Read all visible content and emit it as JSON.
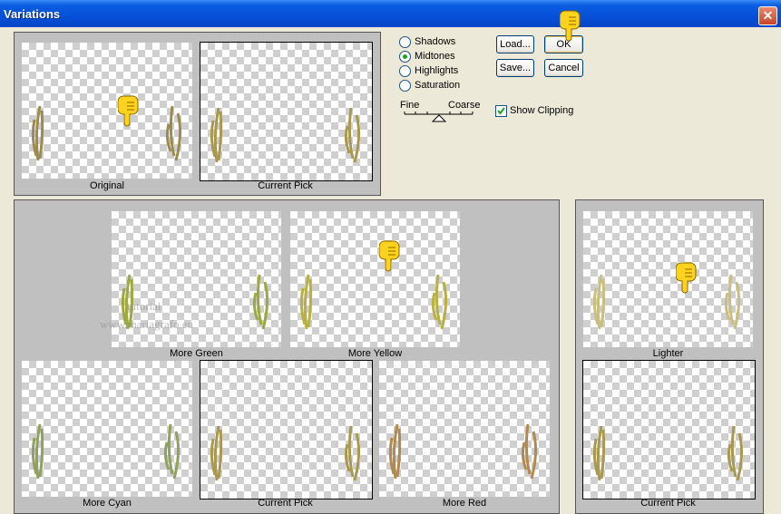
{
  "window": {
    "title": "Variations",
    "close_glyph": "✕"
  },
  "buttons": {
    "load": "Load...",
    "save": "Save...",
    "ok": "OK",
    "cancel": "Cancel"
  },
  "tonal_range": {
    "options": [
      "Shadows",
      "Midtones",
      "Highlights",
      "Saturation"
    ],
    "selected": "Midtones"
  },
  "slider": {
    "min_label": "Fine",
    "max_label": "Coarse"
  },
  "show_clipping": {
    "label": "Show Clipping",
    "checked": true
  },
  "top_thumbnails": {
    "original": "Original",
    "current_pick": "Current Pick"
  },
  "color_grid": {
    "more_green": "More Green",
    "more_yellow": "More Yellow",
    "more_cyan": "More Cyan",
    "current_pick": "Current Pick",
    "more_red": "More Red"
  },
  "lightness": {
    "lighter": "Lighter",
    "current_pick": "Current Pick"
  },
  "watermark": {
    "line1": "tutorial",
    "line2": "www.mariagrafo.eu"
  },
  "colors": {
    "titlebar": "#0550D8",
    "dialog_bg": "#ECE9D8",
    "panel_bg": "#C0C0C0",
    "radio_dot": "#21A121",
    "pointer_yellow": "#FFD21E"
  },
  "icons": {
    "pointer": "pointing-hand-icon",
    "close": "close-icon"
  }
}
